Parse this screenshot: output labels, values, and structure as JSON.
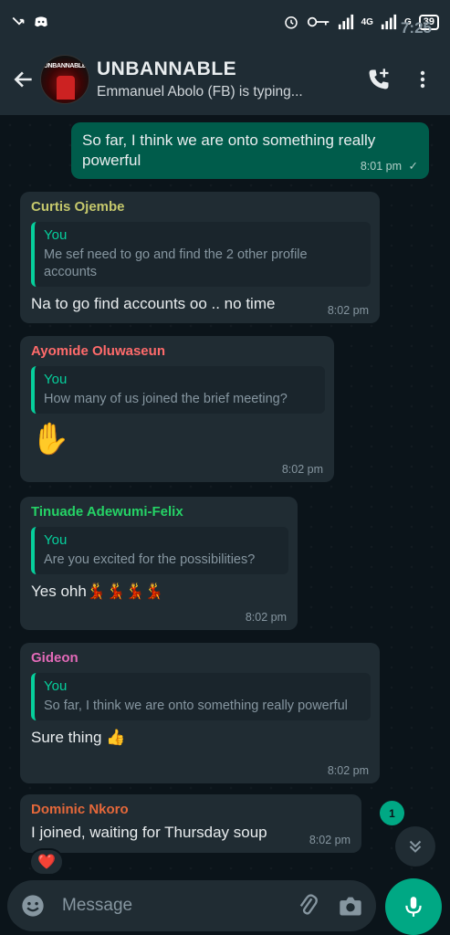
{
  "status": {
    "time": "7:25",
    "network": "4G",
    "network2": "G",
    "battery": "39"
  },
  "header": {
    "title": "UNBANNABLE",
    "subtitle": "Emmanuel Abolo (FB) is typing...",
    "avatar_text": "UNBANNABLE",
    "icons": [
      "back-arrow-icon",
      "add-call-icon",
      "more-vert-icon"
    ]
  },
  "messages": [
    {
      "type": "out",
      "text": "So far, I think we are onto something really powerful",
      "time": "8:01 pm",
      "status": "✓"
    },
    {
      "type": "in",
      "sender": "Curtis Ojembe",
      "sender_color": "#c5c86c",
      "quote_author": "You",
      "quote_text": "Me sef need to go and find the 2 other profile accounts",
      "text": "Na to go find accounts oo .. no time",
      "time": "8:02 pm"
    },
    {
      "type": "in",
      "sender": "Ayomide Oluwaseun",
      "sender_color": "#ff6b6b",
      "quote_author": "You",
      "quote_text": "How many of us joined the brief meeting?",
      "text": "✋",
      "time": "8:02 pm"
    },
    {
      "type": "in",
      "sender": "Tinuade Adewumi-Felix",
      "sender_color": "#25d366",
      "quote_author": "You",
      "quote_text": "Are you excited for the possibilities?",
      "text": "Yes ohh💃💃💃💃",
      "time": "8:02 pm"
    },
    {
      "type": "in",
      "sender": "Gideon",
      "sender_color": "#e26ab8",
      "quote_author": "You",
      "quote_text": "So far, I think we are onto something really powerful",
      "text": "Sure thing 👍",
      "time": "8:02 pm"
    },
    {
      "type": "in",
      "sender": "Dominic Nkoro",
      "sender_color": "#e5683a",
      "text": "I joined, waiting for Thursday soup",
      "time": "8:02 pm",
      "reaction": "❤️"
    }
  ],
  "unread_count": "1",
  "input": {
    "placeholder": "Message"
  },
  "colors": {
    "accent": "#00a884",
    "outgoing_bubble": "#005c4b",
    "incoming_bubble": "#202c33",
    "background": "#0b141a"
  }
}
